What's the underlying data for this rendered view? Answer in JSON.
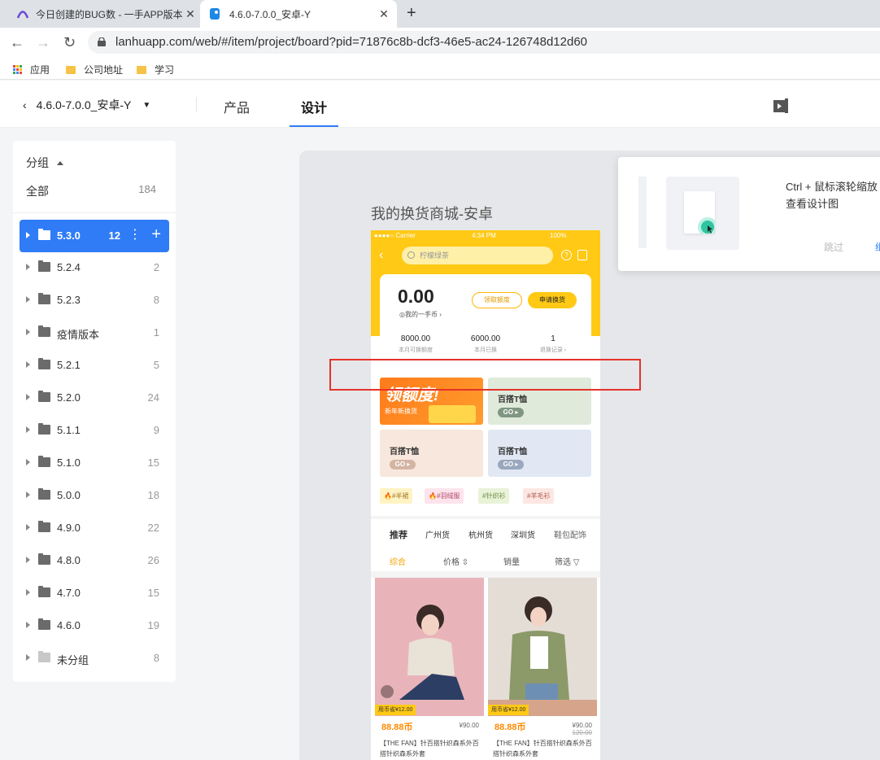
{
  "browser": {
    "tabs": [
      {
        "title": "今日创建的BUG数 - 一手APP版本",
        "icon": "lanhu-arc-icon"
      },
      {
        "title": "4.6.0-7.0.0_安卓-Y",
        "icon": "lanhu-bird-icon"
      }
    ],
    "url": "lanhuapp.com/web/#/item/project/board?pid=71876c8b-dcf3-46e5-ac24-126748d12d60",
    "bookmarks": [
      "应用",
      "公司地址",
      "学习"
    ]
  },
  "header": {
    "project_name": "4.6.0-7.0.0_安卓-Y",
    "tabs": [
      "产品",
      "设计"
    ],
    "active_tab": "设计"
  },
  "sidebar": {
    "group_label": "分组",
    "all": {
      "label": "全部",
      "count": "184"
    },
    "folders": [
      {
        "name": "5.3.0",
        "count": "12"
      },
      {
        "name": "5.2.4",
        "count": "2"
      },
      {
        "name": "5.2.3",
        "count": "8"
      },
      {
        "name": "疫情版本",
        "count": "1"
      },
      {
        "name": "5.2.1",
        "count": "5"
      },
      {
        "name": "5.2.0",
        "count": "24"
      },
      {
        "name": "5.1.1",
        "count": "9"
      },
      {
        "name": "5.1.0",
        "count": "15"
      },
      {
        "name": "5.0.0",
        "count": "18"
      },
      {
        "name": "4.9.0",
        "count": "22"
      },
      {
        "name": "4.8.0",
        "count": "26"
      },
      {
        "name": "4.7.0",
        "count": "15"
      },
      {
        "name": "4.6.0",
        "count": "19"
      },
      {
        "name": "未分组",
        "count": "8"
      }
    ]
  },
  "artboard": {
    "title": "我的换货商城-安卓",
    "status_bar": {
      "carrier": "●●●●○ Carrier",
      "time": "4:34 PM",
      "battery": "100%"
    },
    "search_placeholder": "柠檬绿茶",
    "balance": "0.00",
    "balance_label": "◎我的一手币 ›",
    "btn_receive": "领取额度",
    "btn_apply": "申请换货",
    "stats": [
      {
        "value": "8000.00",
        "label": "本月可换额度"
      },
      {
        "value": "6000.00",
        "label": "本月已换"
      },
      {
        "value": "1",
        "label": "退换记录 ›"
      }
    ],
    "banner": {
      "title": "领额度!",
      "sub": "新年新换货"
    },
    "tiles": [
      {
        "title": "百搭T恤",
        "go": "GO ▸"
      },
      {
        "title": "百搭T恤",
        "go": "GO ▸"
      },
      {
        "title": "百搭T恤",
        "go": "GO ▸"
      }
    ],
    "tags": [
      "🔥#半裙",
      "🔥#羽绒服",
      "#针织衫",
      "#羊毛衫"
    ],
    "categories": [
      "推荐",
      "广州货",
      "杭州货",
      "深圳货",
      "鞋包配饰"
    ],
    "sorts": [
      "综合",
      "价格 ⇳",
      "销量",
      "筛选 ▽"
    ],
    "products": [
      {
        "badge": "用币省¥12.00",
        "price": "88.88币",
        "old": "¥90.00",
        "old2": "",
        "desc": "【THE FAN】针百搭针织森系外百搭针织森系外套"
      },
      {
        "badge": "用币省¥12.00",
        "price": "88.88币",
        "old": "¥90.00",
        "old2": "120.00",
        "desc": "【THE FAN】针百搭针织森系外百搭针织森系外套"
      }
    ]
  },
  "popup": {
    "line1": "Ctrl + 鼠标滚轮缩放",
    "line2": "查看设计图",
    "skip": "跳过",
    "next": "继"
  },
  "colors": {
    "accent": "#2f7cf6",
    "brand_yellow": "#ffc915",
    "highlight_red": "#e5332a"
  }
}
